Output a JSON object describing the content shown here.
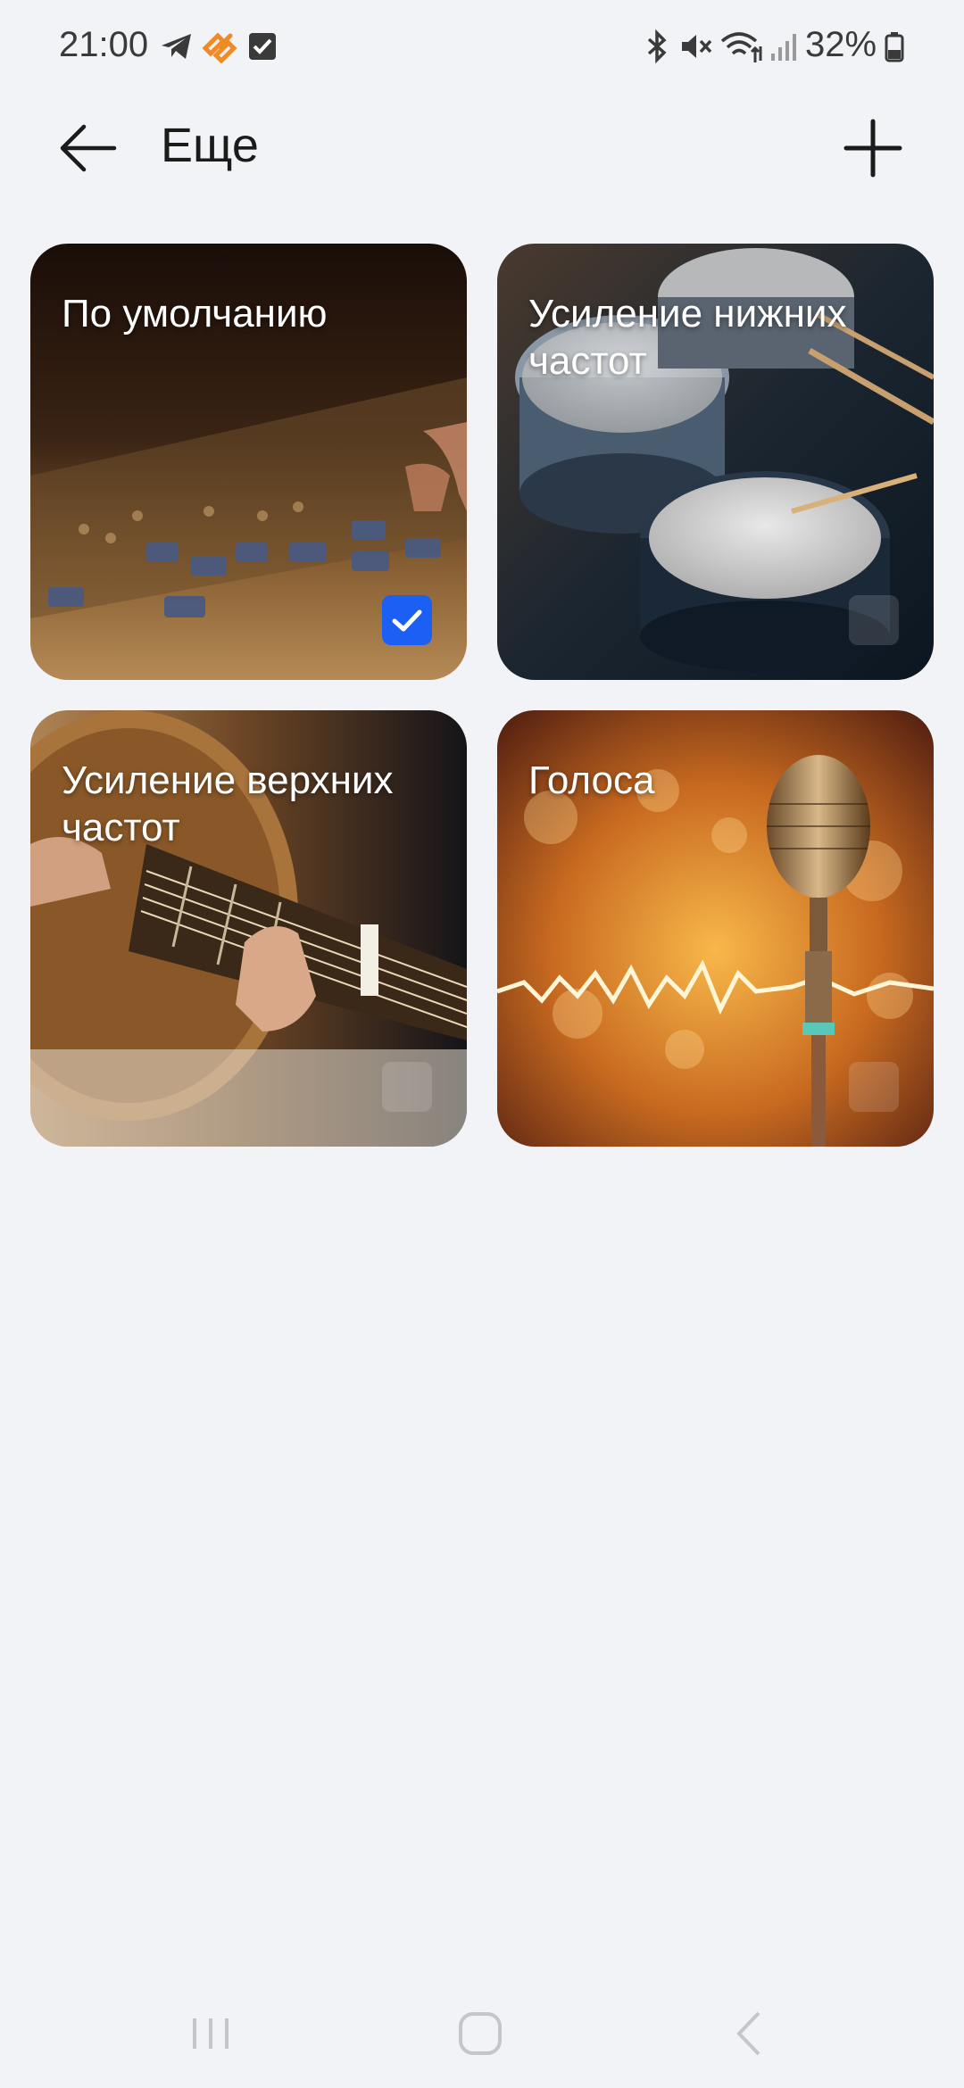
{
  "status_bar": {
    "time": "21:00",
    "left_icons": [
      "telegram-icon",
      "app-notification-icon",
      "checkbox-notification-icon"
    ],
    "right_icons": [
      "bluetooth-icon",
      "mute-icon",
      "wifi-icon",
      "signal-icon",
      "battery-icon"
    ],
    "battery": "32%"
  },
  "header": {
    "title": "Еще",
    "back_icon": "arrow-left-icon",
    "add_icon": "plus-icon"
  },
  "presets": [
    {
      "label": "По умолчанию",
      "checked": true,
      "image": "mixing-console"
    },
    {
      "label": "Усиление нижних частот",
      "checked": false,
      "image": "drum-kit"
    },
    {
      "label": "Усиление верхних частот",
      "checked": false,
      "image": "acoustic-guitar"
    },
    {
      "label": "Голоса",
      "checked": false,
      "image": "vintage-microphone"
    }
  ],
  "colors": {
    "background": "#f1f3f6",
    "checkbox_checked": "#1b5ff5",
    "text": "#1b1b1b"
  },
  "nav_bar": {
    "icons": [
      "recent-apps-icon",
      "home-icon",
      "back-icon"
    ]
  }
}
